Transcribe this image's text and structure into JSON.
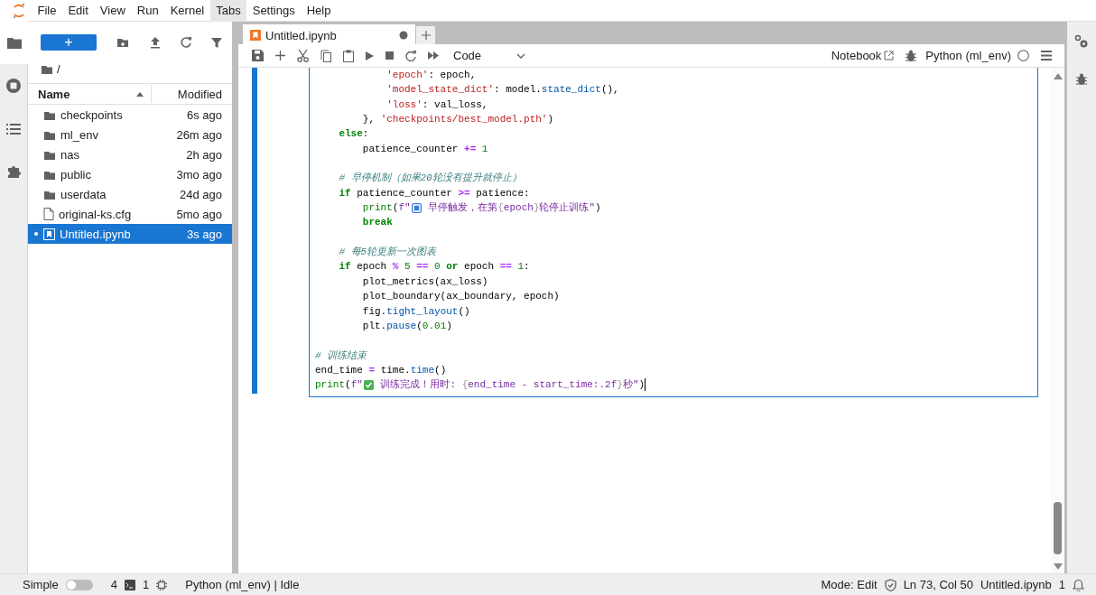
{
  "menu": [
    {
      "label": "File",
      "selected": false
    },
    {
      "label": "Edit",
      "selected": false
    },
    {
      "label": "View",
      "selected": false
    },
    {
      "label": "Run",
      "selected": false
    },
    {
      "label": "Kernel",
      "selected": false
    },
    {
      "label": "Tabs",
      "selected": true
    },
    {
      "label": "Settings",
      "selected": false
    },
    {
      "label": "Help",
      "selected": false
    }
  ],
  "file_browser": {
    "new_button": "+",
    "path": "/",
    "columns": [
      {
        "label": "Name",
        "sorted": true
      },
      {
        "label": "Modified",
        "sorted": false
      }
    ],
    "items": [
      {
        "kind": "folder",
        "name": "checkpoints",
        "modified": "6s ago",
        "selected": false,
        "running": false
      },
      {
        "kind": "folder",
        "name": "ml_env",
        "modified": "26m ago",
        "selected": false,
        "running": false
      },
      {
        "kind": "folder",
        "name": "nas",
        "modified": "2h ago",
        "selected": false,
        "running": false
      },
      {
        "kind": "folder",
        "name": "public",
        "modified": "3mo ago",
        "selected": false,
        "running": false
      },
      {
        "kind": "folder",
        "name": "userdata",
        "modified": "24d ago",
        "selected": false,
        "running": false
      },
      {
        "kind": "file",
        "name": "original-ks.cfg",
        "modified": "5mo ago",
        "selected": false,
        "running": false
      },
      {
        "kind": "notebook",
        "name": "Untitled.ipynb",
        "modified": "3s ago",
        "selected": true,
        "running": true
      }
    ]
  },
  "tabs": [
    {
      "label": "Untitled.ipynb",
      "selected": true,
      "unsaved": true
    }
  ],
  "toolbar": {
    "cell_type": "Code",
    "notebook_label": "Notebook",
    "kernel": "Python (ml_env)"
  },
  "code_lines": [
    {
      "kind": "code",
      "tokens": [
        {
          "kind": "str",
          "text": "            'epoch'"
        },
        {
          "kind": "plain",
          "text": ": epoch,"
        }
      ]
    },
    {
      "kind": "code",
      "tokens": [
        {
          "kind": "str",
          "text": "            'model_state_dict'"
        },
        {
          "kind": "plain",
          "text": ": model."
        },
        {
          "kind": "fn",
          "text": "state_dict"
        },
        {
          "kind": "plain",
          "text": "(),"
        }
      ]
    },
    {
      "kind": "code",
      "tokens": [
        {
          "kind": "str",
          "text": "            'loss'"
        },
        {
          "kind": "plain",
          "text": ": val_loss,"
        }
      ]
    },
    {
      "kind": "code",
      "tokens": [
        {
          "kind": "plain",
          "text": "        }, "
        },
        {
          "kind": "str",
          "text": "'checkpoints/best_model.pth'"
        },
        {
          "kind": "plain",
          "text": ")"
        }
      ]
    },
    {
      "kind": "code",
      "tokens": [
        {
          "kind": "kw",
          "text": "    else"
        },
        {
          "kind": "plain",
          "text": ":"
        }
      ]
    },
    {
      "kind": "code",
      "tokens": [
        {
          "kind": "plain",
          "text": "        patience_counter "
        },
        {
          "kind": "op",
          "text": "+="
        },
        {
          "kind": "num",
          "text": " 1"
        }
      ]
    },
    {
      "kind": "blank"
    },
    {
      "kind": "code",
      "tokens": [
        {
          "kind": "com",
          "text": "    # 早停机制（如果20轮没有提升就停止）"
        }
      ]
    },
    {
      "kind": "code",
      "tokens": [
        {
          "kind": "kw",
          "text": "    if"
        },
        {
          "kind": "plain",
          "text": " patience_counter "
        },
        {
          "kind": "op",
          "text": ">="
        },
        {
          "kind": "plain",
          "text": " patience:"
        }
      ]
    },
    {
      "kind": "code",
      "tokens": [
        {
          "kind": "builtin",
          "text": "        print"
        },
        {
          "kind": "plain",
          "text": "("
        },
        {
          "kind": "fstr",
          "text": "f\""
        },
        {
          "kind": "square"
        },
        {
          "kind": "fstr",
          "text": " 早停触发，在第"
        },
        {
          "kind": "brace",
          "text": "{"
        },
        {
          "kind": "fstr",
          "text": "epoch"
        },
        {
          "kind": "brace",
          "text": "}"
        },
        {
          "kind": "fstr",
          "text": "轮停止训练\""
        },
        {
          "kind": "plain",
          "text": ")"
        }
      ]
    },
    {
      "kind": "code",
      "tokens": [
        {
          "kind": "kw",
          "text": "        break"
        }
      ]
    },
    {
      "kind": "blank"
    },
    {
      "kind": "code",
      "tokens": [
        {
          "kind": "com",
          "text": "    # 每5轮更新一次图表"
        }
      ]
    },
    {
      "kind": "code",
      "tokens": [
        {
          "kind": "kw",
          "text": "    if"
        },
        {
          "kind": "plain",
          "text": " epoch "
        },
        {
          "kind": "op",
          "text": "%"
        },
        {
          "kind": "num",
          "text": " 5 "
        },
        {
          "kind": "op",
          "text": "=="
        },
        {
          "kind": "num",
          "text": " 0 "
        },
        {
          "kind": "kw",
          "text": "or"
        },
        {
          "kind": "plain",
          "text": " epoch "
        },
        {
          "kind": "op",
          "text": "=="
        },
        {
          "kind": "num",
          "text": " 1"
        },
        {
          "kind": "plain",
          "text": ":"
        }
      ]
    },
    {
      "kind": "code",
      "tokens": [
        {
          "kind": "plain",
          "text": "        plot_metrics(ax_loss)"
        }
      ]
    },
    {
      "kind": "code",
      "tokens": [
        {
          "kind": "plain",
          "text": "        plot_boundary(ax_boundary, epoch)"
        }
      ]
    },
    {
      "kind": "code",
      "tokens": [
        {
          "kind": "plain",
          "text": "        fig."
        },
        {
          "kind": "fn",
          "text": "tight_layout"
        },
        {
          "kind": "plain",
          "text": "()"
        }
      ]
    },
    {
      "kind": "code",
      "tokens": [
        {
          "kind": "plain",
          "text": "        plt."
        },
        {
          "kind": "fn",
          "text": "pause"
        },
        {
          "kind": "plain",
          "text": "("
        },
        {
          "kind": "num",
          "text": "0.01"
        },
        {
          "kind": "plain",
          "text": ")"
        }
      ]
    },
    {
      "kind": "blank"
    },
    {
      "kind": "code",
      "tokens": [
        {
          "kind": "com",
          "text": "# 训练结束"
        }
      ]
    },
    {
      "kind": "code",
      "tokens": [
        {
          "kind": "plain",
          "text": "end_time "
        },
        {
          "kind": "op",
          "text": "="
        },
        {
          "kind": "plain",
          "text": " time."
        },
        {
          "kind": "fn",
          "text": "time"
        },
        {
          "kind": "plain",
          "text": "()"
        }
      ]
    },
    {
      "kind": "code",
      "tokens": [
        {
          "kind": "builtin",
          "text": "print"
        },
        {
          "kind": "plain",
          "text": "("
        },
        {
          "kind": "fstr",
          "text": "f\""
        },
        {
          "kind": "tick"
        },
        {
          "kind": "fstr",
          "text": " 训练完成！用时: "
        },
        {
          "kind": "brace",
          "text": "{"
        },
        {
          "kind": "fstr",
          "text": "end_time - start_time:.2f"
        },
        {
          "kind": "brace",
          "text": "}"
        },
        {
          "kind": "fstr",
          "text": "秒\""
        },
        {
          "kind": "plain",
          "text": ")"
        }
      ]
    }
  ],
  "status_bar": {
    "mode_label": "Simple",
    "simple_on": false,
    "terminals": "4",
    "kernels": "1",
    "kernel_status": "Python (ml_env) | Idle",
    "mode": "Mode: Edit",
    "position": "Ln 73, Col 50",
    "file": "Untitled.ipynb",
    "notifications": "1"
  }
}
